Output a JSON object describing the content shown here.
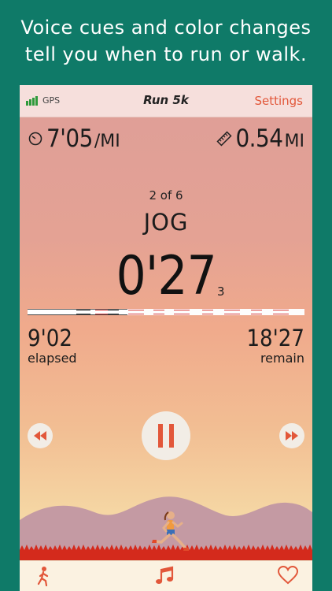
{
  "promo": {
    "line1": "Voice cues and color changes",
    "line2": "tell you when to run or walk."
  },
  "status": {
    "gps_label": "GPS",
    "title": "Run 5k",
    "settings_label": "Settings"
  },
  "stats": {
    "pace_value": "7'05",
    "pace_unit": "/MI",
    "pace_icon": "stopwatch-icon",
    "distance_value": "0.54",
    "distance_unit": "MI",
    "distance_icon": "ruler-icon"
  },
  "interval": {
    "counter": "2 of 6",
    "name": "JOG",
    "countdown": "0'27",
    "tenths": "3",
    "progress_fraction": 0.36
  },
  "elapsed": {
    "value": "9'02",
    "label": "elapsed"
  },
  "remain": {
    "value": "18'27",
    "label": "remain"
  },
  "controls": {
    "rewind_icon": "rewind-icon",
    "pause_icon": "pause-icon",
    "ffwd_icon": "fast-forward-icon"
  },
  "tabs": [
    "runner-icon",
    "music-note-icon",
    "heart-icon"
  ],
  "colors": {
    "accent": "#e2573a",
    "background": "#0f7a68",
    "signal": "#2f9a3c"
  }
}
